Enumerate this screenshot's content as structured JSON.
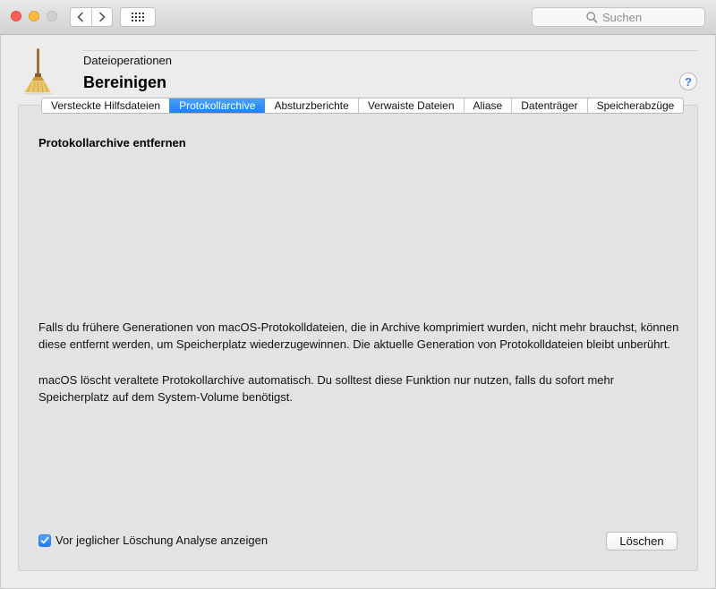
{
  "toolbar": {
    "search_placeholder": "Suchen"
  },
  "header": {
    "category": "Dateioperationen",
    "title": "Bereinigen",
    "help_label": "?"
  },
  "tabs": [
    {
      "label": "Versteckte Hilfsdateien",
      "active": false
    },
    {
      "label": "Protokollarchive",
      "active": true
    },
    {
      "label": "Absturzberichte",
      "active": false
    },
    {
      "label": "Verwaiste Dateien",
      "active": false
    },
    {
      "label": "Aliase",
      "active": false
    },
    {
      "label": "Datenträger",
      "active": false
    },
    {
      "label": "Speicherabzüge",
      "active": false
    }
  ],
  "main": {
    "section_title": "Protokollarchive entfernen",
    "description_1": "Falls du frühere Generationen von macOS-Protokolldateien, die in Archive komprimiert wurden, nicht mehr brauchst, können diese entfernt werden, um Speicherplatz wiederzugewinnen. Die aktuelle Generation von Protokolldateien bleibt unberührt.",
    "description_2": "macOS löscht veraltete Protokollarchive automatisch. Du solltest diese Funktion nur nutzen, falls du sofort mehr Speicherplatz auf dem System-Volume benötigst.",
    "checkbox_label": "Vor jeglicher Löschung Analyse anzeigen",
    "checkbox_checked": true,
    "delete_button_label": "Löschen"
  },
  "colors": {
    "accent": "#1f7ff6",
    "close": "#fc605c",
    "minimize": "#fdbc40"
  }
}
